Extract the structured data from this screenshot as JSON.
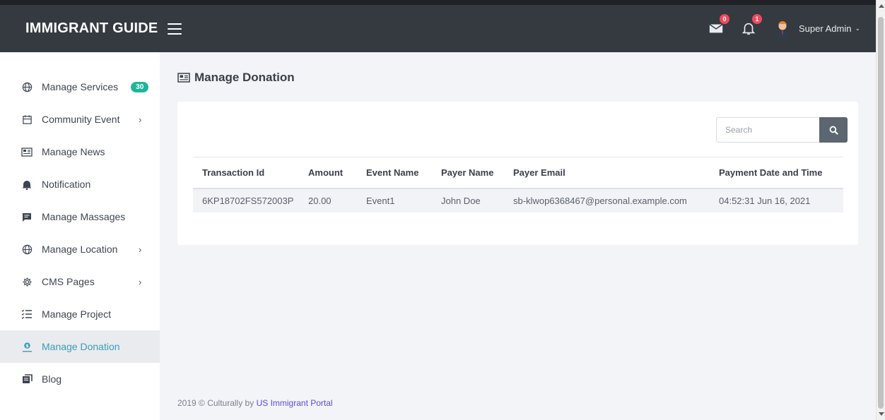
{
  "brand": {
    "title": "IMMIGRANT GUIDE"
  },
  "header": {
    "messages_badge": "0",
    "notifications_badge": "1",
    "user_name": "Super Admin",
    "user_chevron": "⌄"
  },
  "sidebar": {
    "items": [
      {
        "label": "Manage Services",
        "icon": "globe-icon",
        "count": "30"
      },
      {
        "label": "Community Event",
        "icon": "calendar-icon",
        "chevron": "›"
      },
      {
        "label": "Manage News",
        "icon": "newspaper-icon"
      },
      {
        "label": "Notification",
        "icon": "bell-icon"
      },
      {
        "label": "Manage Massages",
        "icon": "message-icon"
      },
      {
        "label": "Manage Location",
        "icon": "globe-icon",
        "chevron": "›"
      },
      {
        "label": "CMS Pages",
        "icon": "gear-icon",
        "chevron": "›"
      },
      {
        "label": "Manage Project",
        "icon": "list-icon"
      },
      {
        "label": "Manage Donation",
        "icon": "donation-icon",
        "active": true
      },
      {
        "label": "Blog",
        "icon": "blog-icon"
      }
    ]
  },
  "main": {
    "title": "Manage Donation",
    "search": {
      "placeholder": "Search"
    },
    "table": {
      "columns": [
        "Transaction Id",
        "Amount",
        "Event Name",
        "Payer Name",
        "Payer Email",
        "Payment Date and Time"
      ],
      "rows": [
        [
          "6KP18702FS572003P",
          "20.00",
          "Event1",
          "John Doe",
          "sb-klwop6368467@personal.example.com",
          "04:52:31 Jun 16, 2021"
        ]
      ]
    }
  },
  "footer": {
    "prefix": "2019 © Culturally by ",
    "link": "US Immigrant Portal"
  },
  "colors": {
    "topbar": "#343a40",
    "badge": "#ef4a5c",
    "count_badge": "#1fb59a",
    "active_link": "#3d9bb9",
    "footer_link": "#5b4cdb"
  }
}
